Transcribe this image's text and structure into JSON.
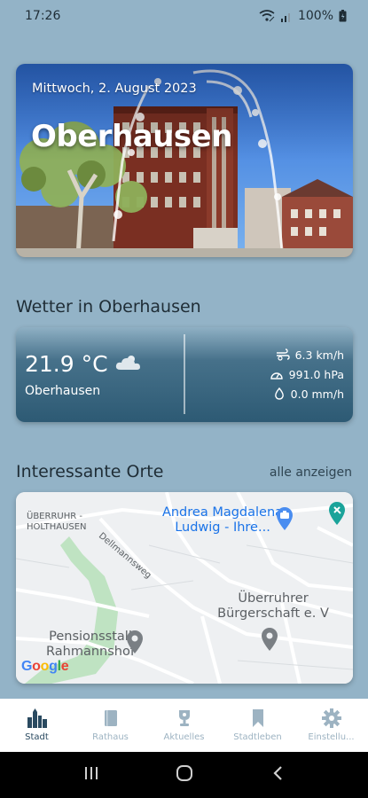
{
  "status_bar": {
    "time": "17:26",
    "battery": "100%",
    "icons": [
      "wifi-icon",
      "signal-icon",
      "battery-icon"
    ]
  },
  "hero": {
    "date": "Mittwoch, 2. August 2023",
    "city": "Oberhausen",
    "image": "town-hall-fountain-photo"
  },
  "weather_section": {
    "title": "Wetter in Oberhausen",
    "temperature": "21.9 °C",
    "location": "Oberhausen",
    "condition_icon": "partly-cloudy-icon",
    "wind": "6.3 km/h",
    "pressure": "991.0 hPa",
    "precipitation": "0.0 mm/h"
  },
  "places_section": {
    "title": "Interessante Orte",
    "show_all": "alle anzeigen",
    "map": {
      "district_label": [
        "ÜBERRUHR -",
        "HOLTHAUSEN"
      ],
      "street_label": "Dellmannsweg",
      "pois": [
        {
          "name": [
            "Andrea Magdalena",
            "Ludwig - Ihre..."
          ],
          "color": "blue"
        },
        {
          "name": [
            "Überruhrer",
            "Bürgerschaft e. V"
          ],
          "color": "gray"
        },
        {
          "name": [
            "Pensionsstall",
            "Rahmannshof"
          ],
          "color": "gray"
        }
      ],
      "provider": "Google"
    }
  },
  "bottom_nav": {
    "items": [
      {
        "label": "Stadt",
        "icon": "city-skyline-icon",
        "active": true
      },
      {
        "label": "Rathaus",
        "icon": "book-icon",
        "active": false
      },
      {
        "label": "Aktuelles",
        "icon": "trophy-icon",
        "active": false
      },
      {
        "label": "Stadtleben",
        "icon": "bookmark-icon",
        "active": false
      },
      {
        "label": "Einstellu...",
        "icon": "gear-icon",
        "active": false
      }
    ]
  },
  "colors": {
    "background": "#93b3c7",
    "accent": "#2a4a60",
    "inactive_nav": "#9db3c2",
    "map_poi_blue": "#1a73e8",
    "map_poi_teal": "#1aa39a"
  }
}
